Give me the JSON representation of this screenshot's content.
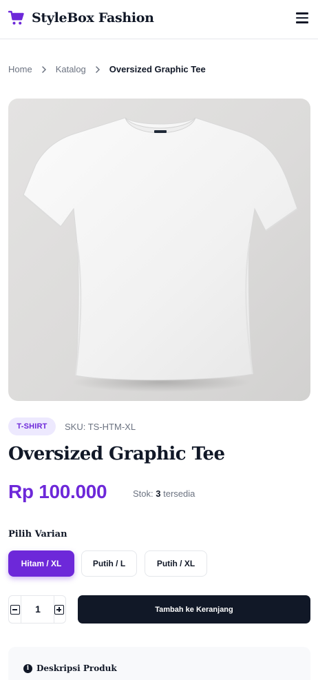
{
  "header": {
    "brand": "StyleBox Fashion",
    "logo_icon": "shopping-cart-icon",
    "menu_icon": "hamburger-menu-icon"
  },
  "breadcrumb": {
    "items": [
      "Home",
      "Katalog"
    ],
    "current": "Oversized Graphic Tee",
    "separator_icon": "chevron-right-icon"
  },
  "product": {
    "image_alt": "white t-shirt photo",
    "category": "T-SHIRT",
    "sku": "SKU: TS-HTM-XL",
    "name": "Oversized Graphic Tee",
    "price": "Rp 100.000",
    "stock_prefix": "Stok:",
    "stock_count": "3",
    "stock_suffix": "tersedia"
  },
  "variants": {
    "label": "Pilih Varian",
    "options": [
      "Hitam / XL",
      "Putih / L",
      "Putih / XL"
    ],
    "selected": "Hitam / XL"
  },
  "cart": {
    "quantity": "1",
    "add_button": "Tambah ke Keranjang"
  },
  "description": {
    "title": "Deskripsi Produk",
    "icon": "info-icon"
  },
  "colors": {
    "accent": "#6d28d9",
    "accent_light": "#ede9fe",
    "dark": "#111827",
    "muted": "#6b7280"
  }
}
